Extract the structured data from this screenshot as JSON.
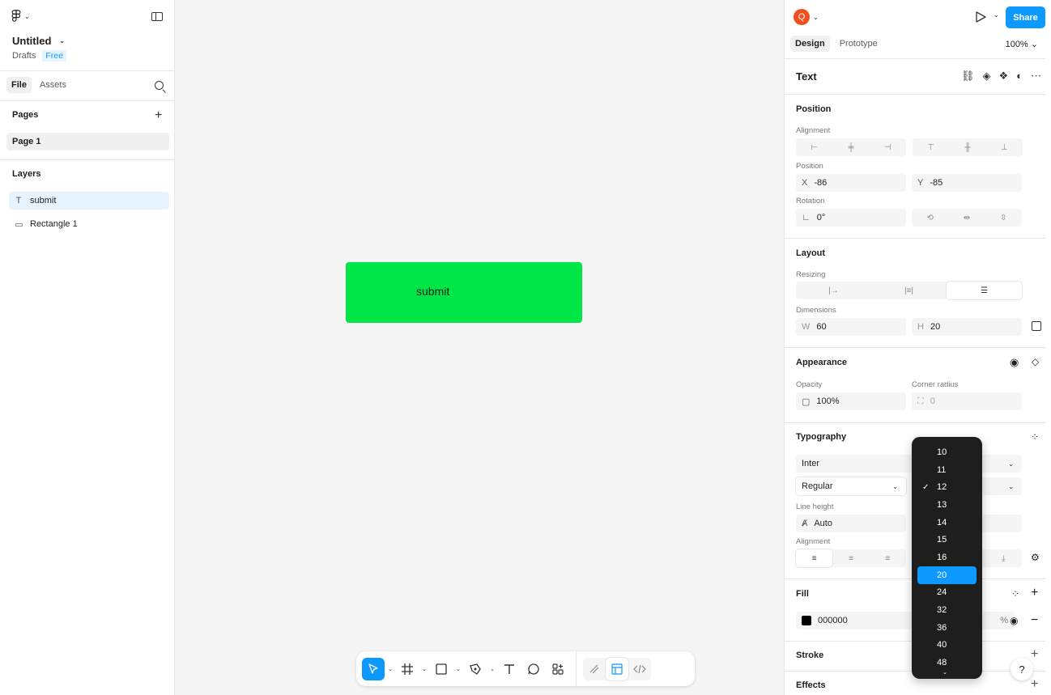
{
  "left_panel": {
    "file_title": "Untitled",
    "location": "Drafts",
    "plan_badge": "Free",
    "tabs": [
      "File",
      "Assets"
    ],
    "pages_heading": "Pages",
    "pages": [
      "Page 1"
    ],
    "layers_heading": "Layers",
    "layers": [
      {
        "name": "submit",
        "icon": "text-icon",
        "selected": true
      },
      {
        "name": "Rectangle 1",
        "icon": "rectangle-icon",
        "selected": false
      }
    ]
  },
  "canvas": {
    "button_text": "submit",
    "button_color": "#00e646"
  },
  "toolbar": {
    "tools": [
      "move-tool",
      "frame-tool",
      "shape-tool",
      "pen-tool",
      "text-tool",
      "comment-tool",
      "actions-tool",
      "draw-mode",
      "design-mode",
      "dev-mode"
    ]
  },
  "right_panel": {
    "avatar_letter": "Q",
    "share_label": "Share",
    "tabs": [
      "Design",
      "Prototype"
    ],
    "zoom": "100%",
    "selection_title": "Text",
    "position": {
      "heading": "Position",
      "alignment_label": "Alignment",
      "position_label": "Position",
      "x_key": "X",
      "x_value": "-86",
      "y_key": "Y",
      "y_value": "-85",
      "rotation_label": "Rotation",
      "rotation_value": "0°"
    },
    "layout": {
      "heading": "Layout",
      "resizing_label": "Resizing",
      "dimensions_label": "Dimensions",
      "w_key": "W",
      "w_value": "60",
      "h_key": "H",
      "h_value": "20"
    },
    "appearance": {
      "heading": "Appearance",
      "opacity_label": "Opacity",
      "opacity_value": "100%",
      "corner_label": "Corner radius",
      "corner_value": "0"
    },
    "typography": {
      "heading": "Typography",
      "font_family": "Inter",
      "font_weight": "Regular",
      "line_height_label": "Line height",
      "line_height_value": "Auto",
      "alignment_label": "Alignment"
    },
    "fill": {
      "heading": "Fill",
      "hex": "000000",
      "percent_sign": "%",
      "swatch": "#000000"
    },
    "stroke_heading": "Stroke",
    "effects_heading": "Effects"
  },
  "font_size_dropdown": {
    "options": [
      "10",
      "11",
      "12",
      "13",
      "14",
      "15",
      "16",
      "20",
      "24",
      "32",
      "36",
      "40",
      "48"
    ],
    "checked": "12",
    "highlighted": "20"
  },
  "help_label": "?"
}
